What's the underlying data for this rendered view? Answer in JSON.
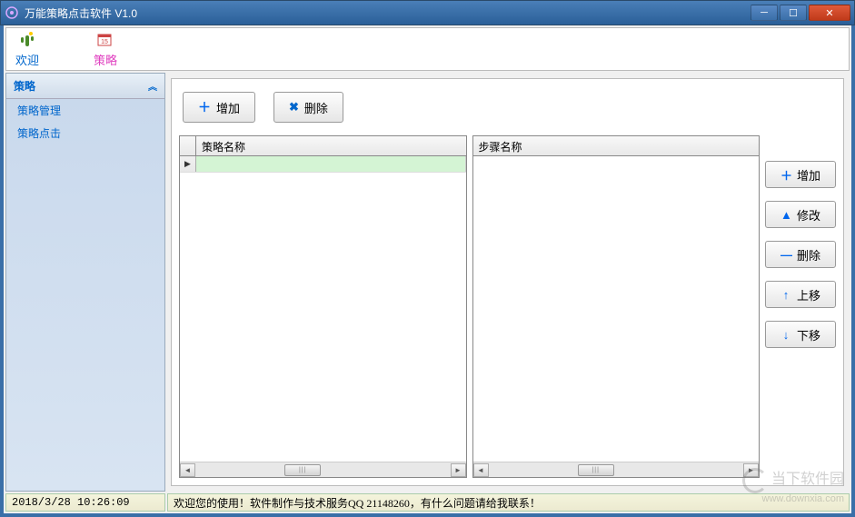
{
  "window": {
    "title": "万能策略点击软件 V1.0"
  },
  "toolbar": {
    "welcome_label": "欢迎",
    "strategy_label": "策略"
  },
  "sidebar": {
    "header": "策略",
    "items": [
      "策略管理",
      "策略点击"
    ]
  },
  "top_actions": {
    "add_label": "增加",
    "delete_label": "删除"
  },
  "grid_left": {
    "header": "策略名称",
    "rows": [
      ""
    ]
  },
  "grid_right": {
    "header": "步骤名称",
    "rows": []
  },
  "side_actions": {
    "add": "增加",
    "edit": "修改",
    "delete": "删除",
    "up": "上移",
    "down": "下移"
  },
  "statusbar": {
    "timestamp": "2018/3/28 10:26:09",
    "message": "欢迎您的使用！软件制作与技术服务QQ 21148260，有什么问题请给我联系！"
  },
  "watermark": {
    "title": "当下软件园",
    "url": "www.downxia.com"
  }
}
